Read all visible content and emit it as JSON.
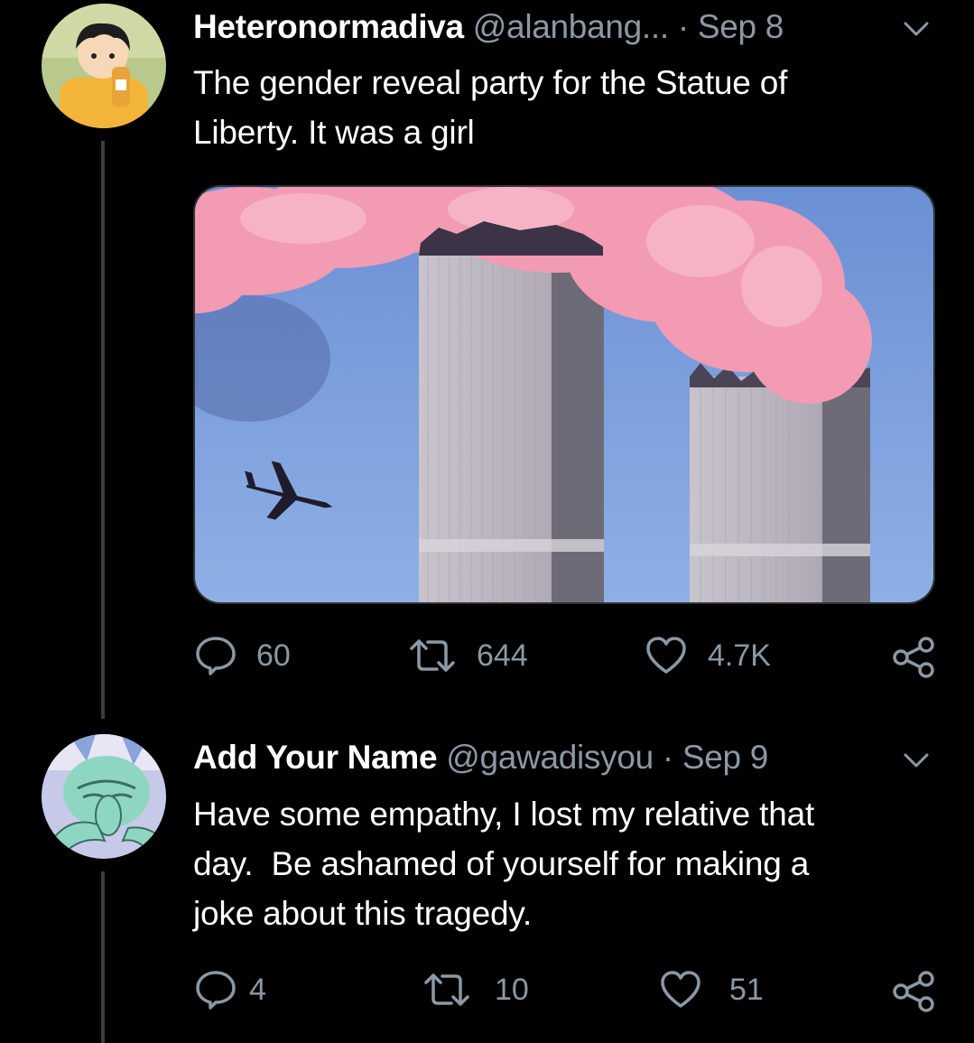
{
  "tweets": [
    {
      "display_name": "Heteronormadiva",
      "handle": "@alanbang...",
      "separator": "·",
      "date": "Sep 8",
      "text_lines": [
        "The gender reveal party for the Statue of",
        "Liberty. It was a girl"
      ],
      "stats": {
        "replies": "60",
        "retweets": "644",
        "likes": "4.7K"
      }
    },
    {
      "display_name": "Add Your Name",
      "handle": "@gawadisyou",
      "separator": "·",
      "date": "Sep 9",
      "text_lines": [
        "Have some empathy, I lost my relative that",
        "day.  Be ashamed of yourself for making a",
        "joke about this tragedy."
      ],
      "stats": {
        "replies": "4",
        "retweets": "10",
        "likes": "51"
      }
    }
  ],
  "icons": {
    "reply": "reply-icon",
    "retweet": "retweet-icon",
    "like": "heart-icon",
    "share": "share-icon",
    "more": "chevron-down-icon"
  },
  "colors": {
    "background": "#000000",
    "meta_text": "#8b98a5",
    "thread_line": "#3a3d41",
    "smoke_pink": "#f08aa6",
    "sky": "#6f93d6"
  }
}
